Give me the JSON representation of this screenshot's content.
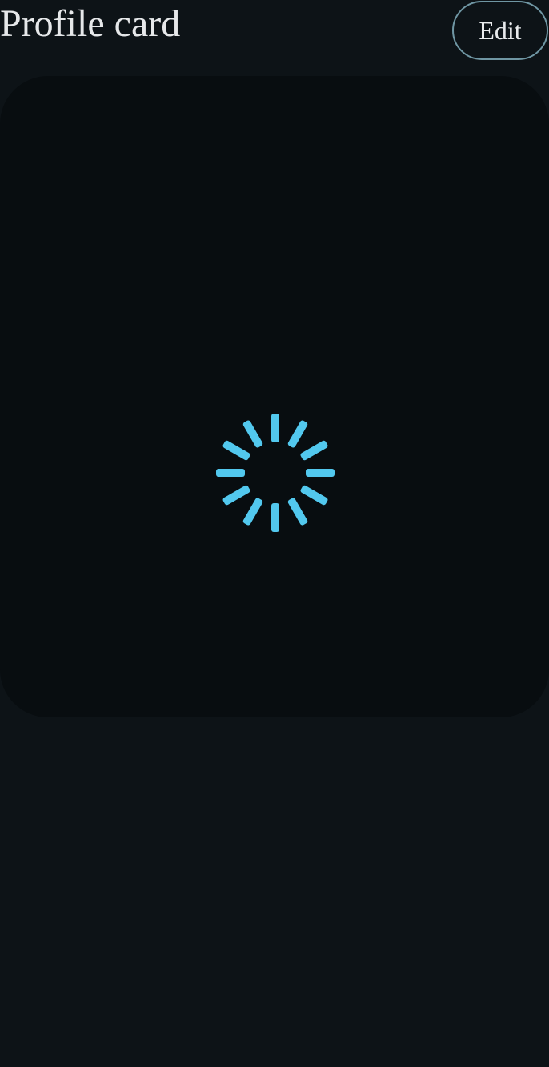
{
  "header": {
    "title": "Profile card",
    "edit_label": "Edit"
  },
  "card": {
    "state": "loading",
    "spinner_icon": "loading-spinner-icon"
  },
  "colors": {
    "background": "#0d1317",
    "card_background": "#080d10",
    "title_text": "#e6e8ea",
    "button_border": "#6f96a3",
    "spinner": "#52c8ee"
  }
}
